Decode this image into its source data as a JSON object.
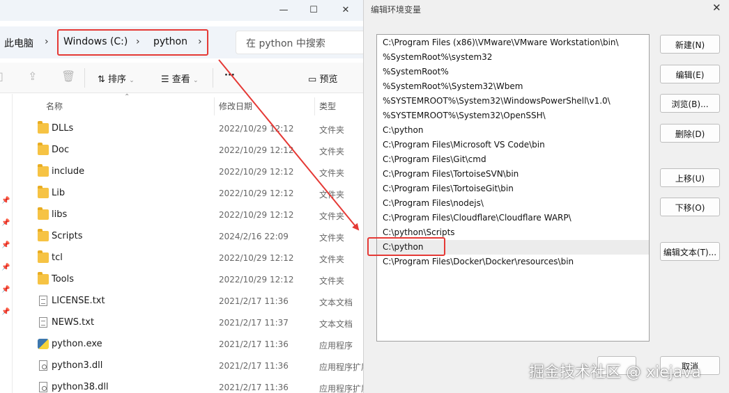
{
  "explorer": {
    "window_controls": {
      "minimize": "—",
      "maximize": "☐",
      "close": "✕"
    },
    "breadcrumb": [
      {
        "label": "此电脑"
      },
      {
        "label": "Windows (C:)"
      },
      {
        "label": "python"
      }
    ],
    "breadcrumb_separator": "›",
    "search_placeholder": "在 python 中搜索",
    "toolbar": {
      "sort": "排序",
      "view": "查看",
      "more": "···",
      "preview": "预览"
    },
    "columns": {
      "name": "名称",
      "modified": "修改日期",
      "type": "类型"
    },
    "files": [
      {
        "name": "DLLs",
        "modified": "2022/10/29 12:12",
        "type": "文件夹",
        "icon": "folder-icon"
      },
      {
        "name": "Doc",
        "modified": "2022/10/29 12:12",
        "type": "文件夹",
        "icon": "folder-icon"
      },
      {
        "name": "include",
        "modified": "2022/10/29 12:12",
        "type": "文件夹",
        "icon": "folder-icon"
      },
      {
        "name": "Lib",
        "modified": "2022/10/29 12:12",
        "type": "文件夹",
        "icon": "folder-icon"
      },
      {
        "name": "libs",
        "modified": "2022/10/29 12:12",
        "type": "文件夹",
        "icon": "folder-icon"
      },
      {
        "name": "Scripts",
        "modified": "2024/2/16 22:09",
        "type": "文件夹",
        "icon": "folder-icon"
      },
      {
        "name": "tcl",
        "modified": "2022/10/29 12:12",
        "type": "文件夹",
        "icon": "folder-icon"
      },
      {
        "name": "Tools",
        "modified": "2022/10/29 12:12",
        "type": "文件夹",
        "icon": "folder-icon"
      },
      {
        "name": "LICENSE.txt",
        "modified": "2021/2/17 11:36",
        "type": "文本文档",
        "icon": "text-file-icon"
      },
      {
        "name": "NEWS.txt",
        "modified": "2021/2/17 11:37",
        "type": "文本文档",
        "icon": "text-file-icon"
      },
      {
        "name": "python.exe",
        "modified": "2021/2/17 11:36",
        "type": "应用程序",
        "icon": "python-exe-icon"
      },
      {
        "name": "python3.dll",
        "modified": "2021/2/17 11:36",
        "type": "应用程序扩展",
        "icon": "dll-file-icon"
      },
      {
        "name": "python38.dll",
        "modified": "2021/2/17 11:36",
        "type": "应用程序扩展",
        "icon": "dll-file-icon"
      }
    ]
  },
  "dialog": {
    "title": "编辑环境变量",
    "close": "✕",
    "paths": [
      "C:\\Program Files (x86)\\VMware\\VMware Workstation\\bin\\",
      "%SystemRoot%\\system32",
      "%SystemRoot%",
      "%SystemRoot%\\System32\\Wbem",
      "%SYSTEMROOT%\\System32\\WindowsPowerShell\\v1.0\\",
      "%SYSTEMROOT%\\System32\\OpenSSH\\",
      "C:\\python",
      "C:\\Program Files\\Microsoft VS Code\\bin",
      "C:\\Program Files\\Git\\cmd",
      "C:\\Program Files\\TortoiseSVN\\bin",
      "C:\\Program Files\\TortoiseGit\\bin",
      "C:\\Program Files\\nodejs\\",
      "C:\\Program Files\\Cloudflare\\Cloudflare WARP\\",
      "C:\\python\\Scripts",
      "C:\\python",
      "C:\\Program Files\\Docker\\Docker\\resources\\bin"
    ],
    "selected_index": 14,
    "buttons": {
      "new": "新建(N)",
      "edit": "编辑(E)",
      "browse": "浏览(B)...",
      "delete": "删除(D)",
      "move_up": "上移(U)",
      "move_down": "下移(O)",
      "edit_text": "编辑文本(T)...",
      "cancel": "取消"
    },
    "watermark": "掘金技术社区 @ xiejava"
  },
  "annotation_color": "#e53935"
}
